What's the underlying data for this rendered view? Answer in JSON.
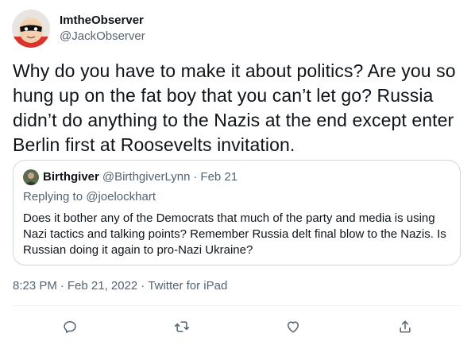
{
  "tweet": {
    "author": {
      "display_name": "ImtheObserver",
      "handle": "@JackObserver"
    },
    "text": "Why do you have to make it about politics? Are you so hung up on the fat boy that you can’t let go? Russia didn’t do anything to the Nazis at the end except enter Berlin first at Roosevelts invitation.",
    "quoted": {
      "display_name": "Birthgiver",
      "handle": "@BirthgiverLynn",
      "separator": "·",
      "date": "Feb 21",
      "replying_prefix": "Replying to",
      "replying_to": "@joelockhart",
      "text": "Does it bother any of the Democrats that much of the party and media is using Nazi tactics and talking points? Remember Russia delt final blow to the Nazis. Is Russian doing it again to pro-Nazi Ukraine?"
    },
    "meta": {
      "time": "8:23 PM",
      "date": "Feb 21, 2022",
      "source": "Twitter for iPad",
      "separator": "·"
    },
    "actions": {
      "reply_icon": "comment-icon",
      "retweet_icon": "retweet-icon",
      "like_icon": "heart-icon",
      "share_icon": "share-icon"
    }
  },
  "colors": {
    "text_primary": "#0f1419",
    "text_secondary": "#536471",
    "border": "#cfd9de"
  }
}
